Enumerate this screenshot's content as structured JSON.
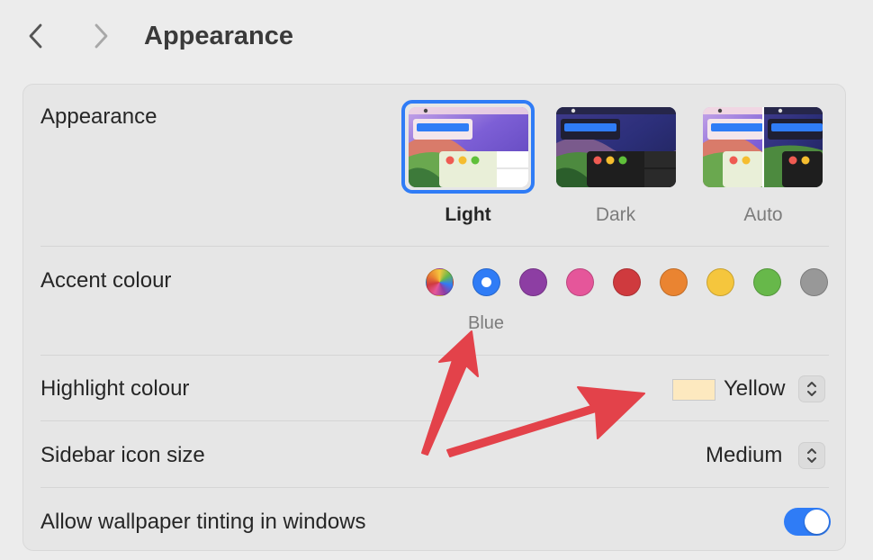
{
  "header": {
    "title": "Appearance"
  },
  "appearance": {
    "label": "Appearance",
    "options": [
      {
        "label": "Light",
        "selected": true
      },
      {
        "label": "Dark",
        "selected": false
      },
      {
        "label": "Auto",
        "selected": false
      }
    ]
  },
  "accent": {
    "label": "Accent colour",
    "selected_name": "Blue",
    "swatches": [
      {
        "name": "multicolour",
        "color": "conic"
      },
      {
        "name": "blue",
        "color": "#2f7cf6",
        "selected": true
      },
      {
        "name": "purple",
        "color": "#8d3ea3"
      },
      {
        "name": "pink",
        "color": "#e5569a"
      },
      {
        "name": "red",
        "color": "#cf3a3e"
      },
      {
        "name": "orange",
        "color": "#ea8431"
      },
      {
        "name": "yellow",
        "color": "#f5c63d"
      },
      {
        "name": "green",
        "color": "#67b84a"
      },
      {
        "name": "graphite",
        "color": "#989898"
      }
    ]
  },
  "highlight": {
    "label": "Highlight colour",
    "value": "Yellow",
    "chip_color": "#fde9bf"
  },
  "sidebar_icon": {
    "label": "Sidebar icon size",
    "value": "Medium"
  },
  "wallpaper_tinting": {
    "label": "Allow wallpaper tinting in windows",
    "enabled": true
  },
  "colors": {
    "accent": "#2f7cf6",
    "annotation_arrow": "#e3424a"
  },
  "icons": {
    "back": "chevron-left-icon",
    "forward": "chevron-right-icon",
    "stepper": "chevron-up-down-icon"
  }
}
